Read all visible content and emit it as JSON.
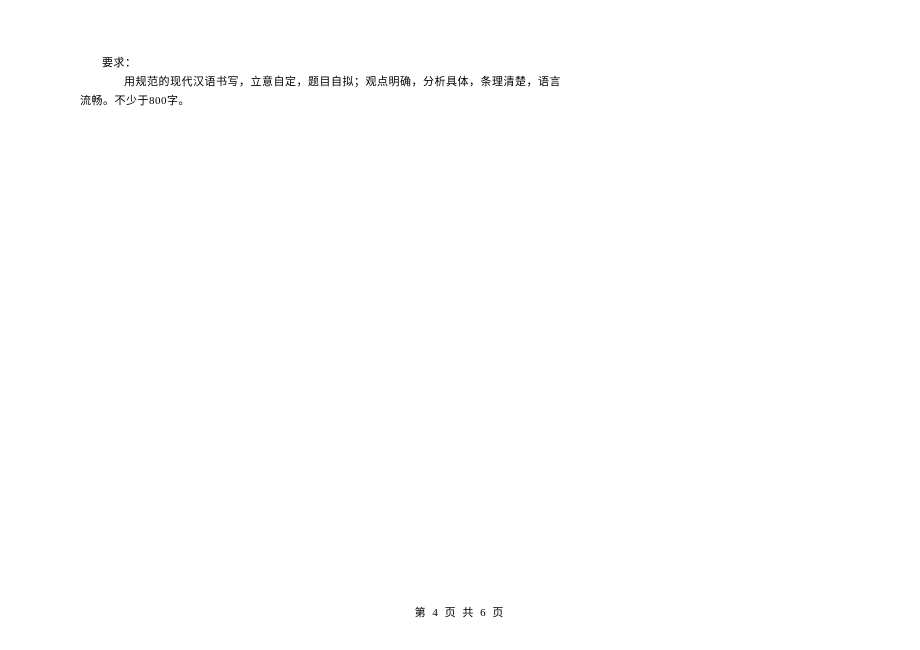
{
  "document": {
    "requirements_label": "要求：",
    "line2_text": "用规范的现代汉语书写，立意自定，题目自拟；观点明确，分析具体，条理清楚，语言",
    "line3_text": "流畅。不少于800字。"
  },
  "footer": {
    "page_indicator": "第 4 页 共 6 页"
  }
}
